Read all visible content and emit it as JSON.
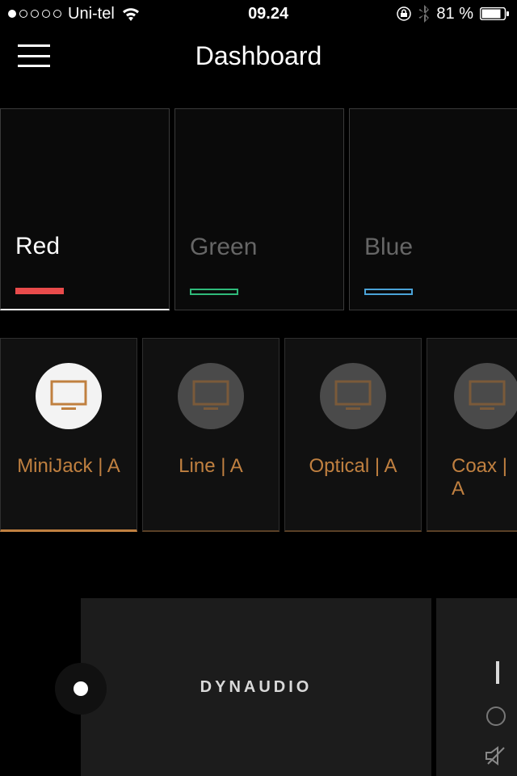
{
  "status": {
    "carrier": "Uni-tel",
    "time": "09.24",
    "battery": "81 %"
  },
  "header": {
    "title": "Dashboard"
  },
  "zones": [
    {
      "name": "Red",
      "color": "#e94b4b",
      "active": true
    },
    {
      "name": "Green",
      "color": "#2fba7a",
      "active": false
    },
    {
      "name": "Blue",
      "color": "#4aa3d8",
      "active": false
    }
  ],
  "sources": [
    {
      "label": "MiniJack | A",
      "selected": true
    },
    {
      "label": "Line | A",
      "selected": false
    },
    {
      "label": "Optical | A",
      "selected": false
    },
    {
      "label": "Coax | A",
      "selected": false
    }
  ],
  "nowplaying": {
    "brand": "DYNAUDIO"
  }
}
